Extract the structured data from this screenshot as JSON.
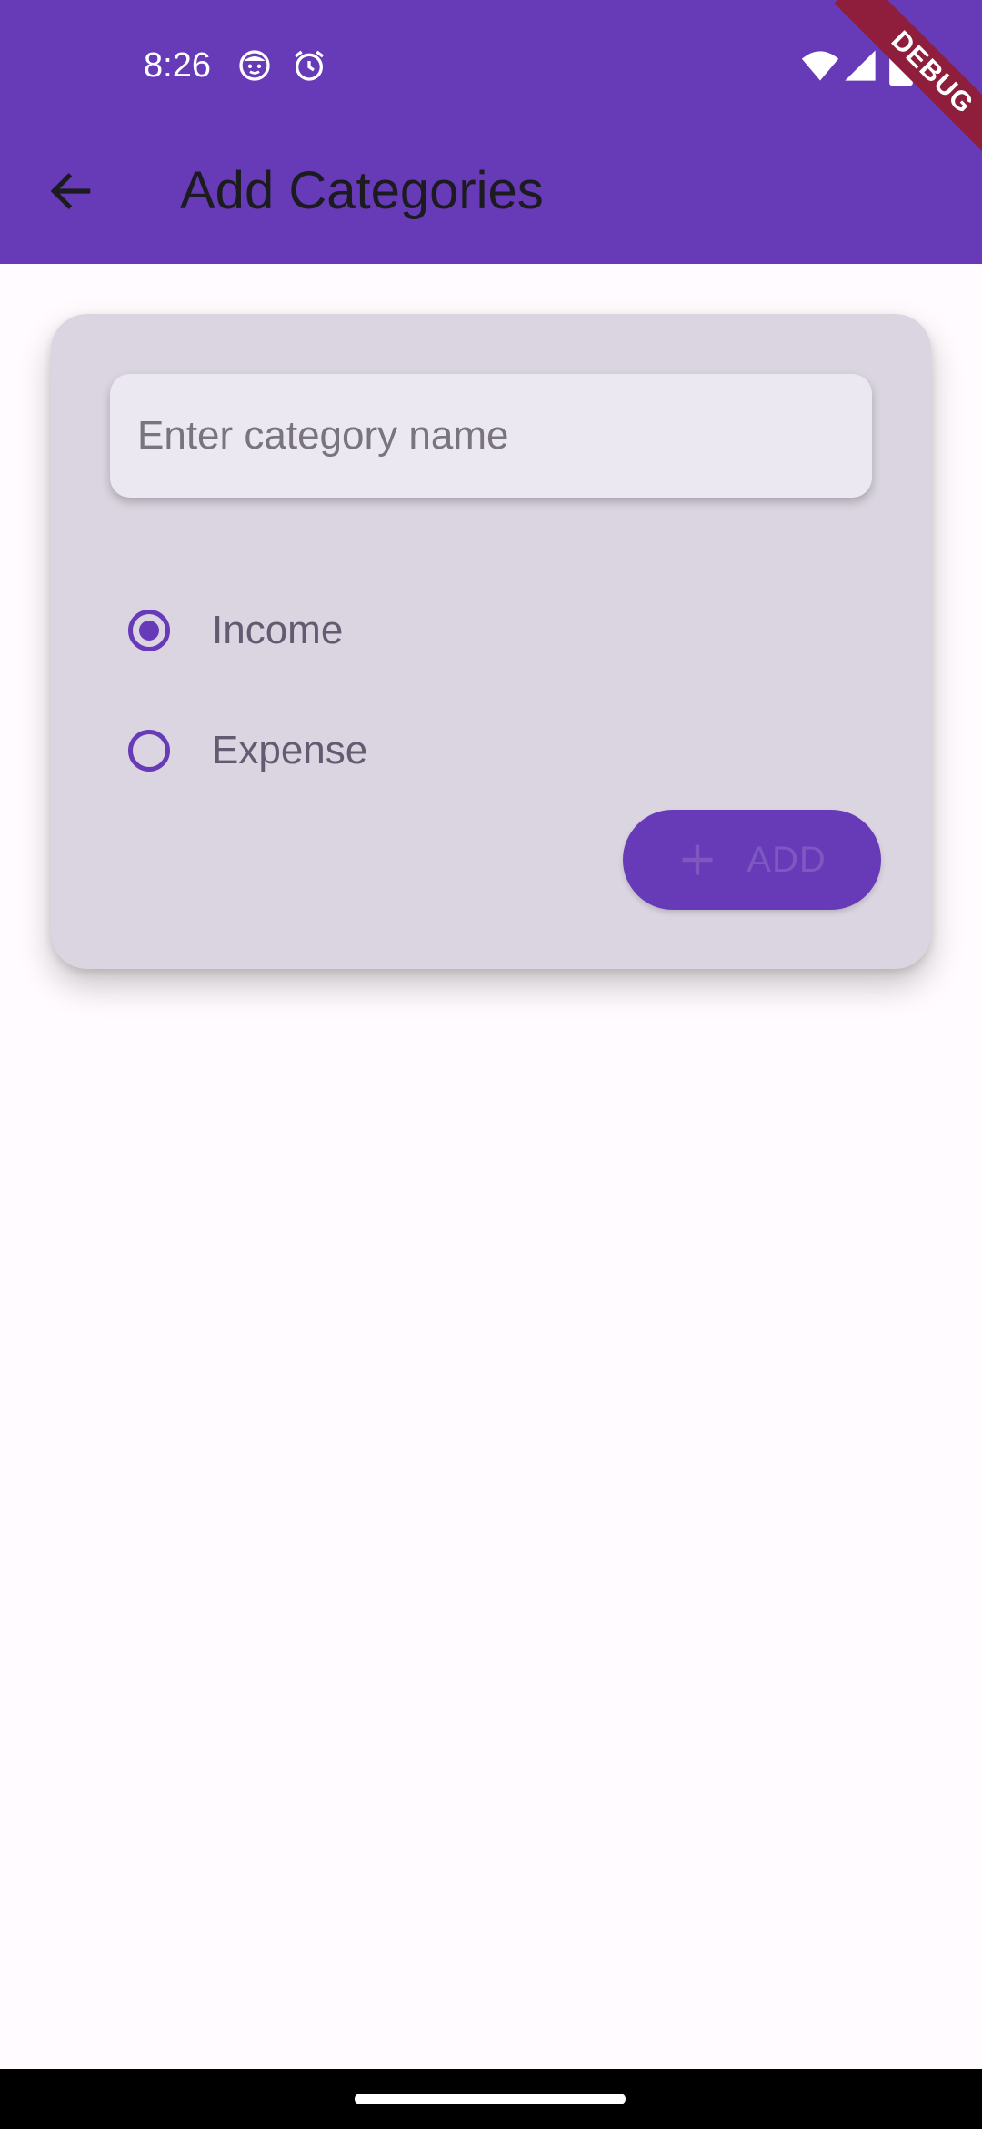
{
  "status_bar": {
    "time": "8:26",
    "icons": [
      "face-notification-icon",
      "alarm-icon",
      "wifi-icon",
      "cell-signal-icon",
      "battery-icon"
    ]
  },
  "app_bar": {
    "back_icon": "arrow-back-icon",
    "title": "Add Categories"
  },
  "debug_banner": {
    "label": "DEBUG"
  },
  "form": {
    "category_name": {
      "value": "",
      "placeholder": "Enter category name"
    },
    "type_options": [
      {
        "label": "Income",
        "selected": true
      },
      {
        "label": "Expense",
        "selected": false
      }
    ],
    "add_button": {
      "icon": "plus-icon",
      "label": "ADD"
    }
  },
  "colors": {
    "primary": "#673AB7",
    "card_background": "#DAD5E0",
    "page_background": "#FFFBFE",
    "debug_banner": "#8E1E3C"
  }
}
